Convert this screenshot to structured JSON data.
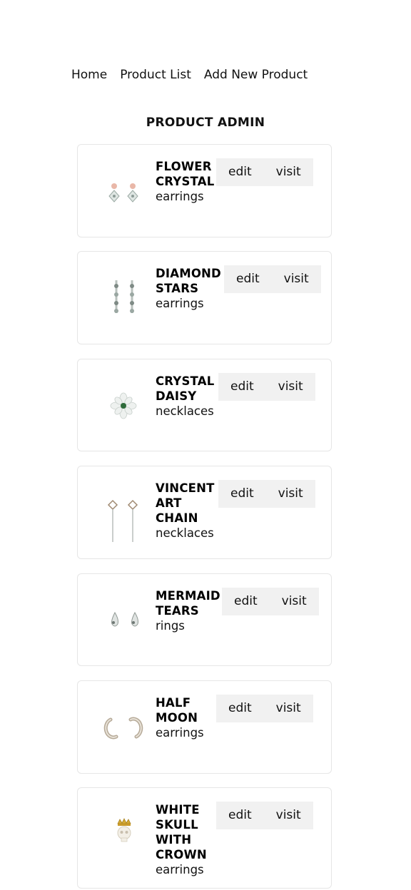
{
  "nav": {
    "home": "Home",
    "product_list": "Product List",
    "add_new_product": "Add New Product"
  },
  "page_title": "PRODUCT ADMIN",
  "products": [
    {
      "name_lines": [
        "FLOWER",
        "CRYSTAL"
      ],
      "category": "earrings",
      "edit": "edit",
      "visit": "visit",
      "icon": "flower-crystal-earrings-image"
    },
    {
      "name_lines": [
        "DIAMOND",
        "STARS"
      ],
      "category": "earrings",
      "edit": "edit",
      "visit": "visit",
      "icon": "diamond-stars-earrings-image"
    },
    {
      "name_lines": [
        "CRYSTAL",
        "DAISY"
      ],
      "category": "necklaces",
      "edit": "edit",
      "visit": "visit",
      "icon": "crystal-daisy-necklace-image"
    },
    {
      "name_lines": [
        "VINCENT",
        "ART",
        "CHAIN"
      ],
      "category": "necklaces",
      "edit": "edit",
      "visit": "visit",
      "icon": "vincent-art-chain-necklace-image"
    },
    {
      "name_lines": [
        "MERMAID",
        "TEARS"
      ],
      "category": "rings",
      "edit": "edit",
      "visit": "visit",
      "icon": "mermaid-tears-ring-image"
    },
    {
      "name_lines": [
        "HALF",
        "MOON"
      ],
      "category": "earrings",
      "edit": "edit",
      "visit": "visit",
      "icon": "half-moon-earrings-image"
    },
    {
      "name_lines": [
        "WHITE",
        "SKULL",
        "WITH",
        "CROWN"
      ],
      "category": "earrings",
      "edit": "edit",
      "visit": "visit",
      "icon": "white-skull-crown-earrings-image"
    }
  ]
}
